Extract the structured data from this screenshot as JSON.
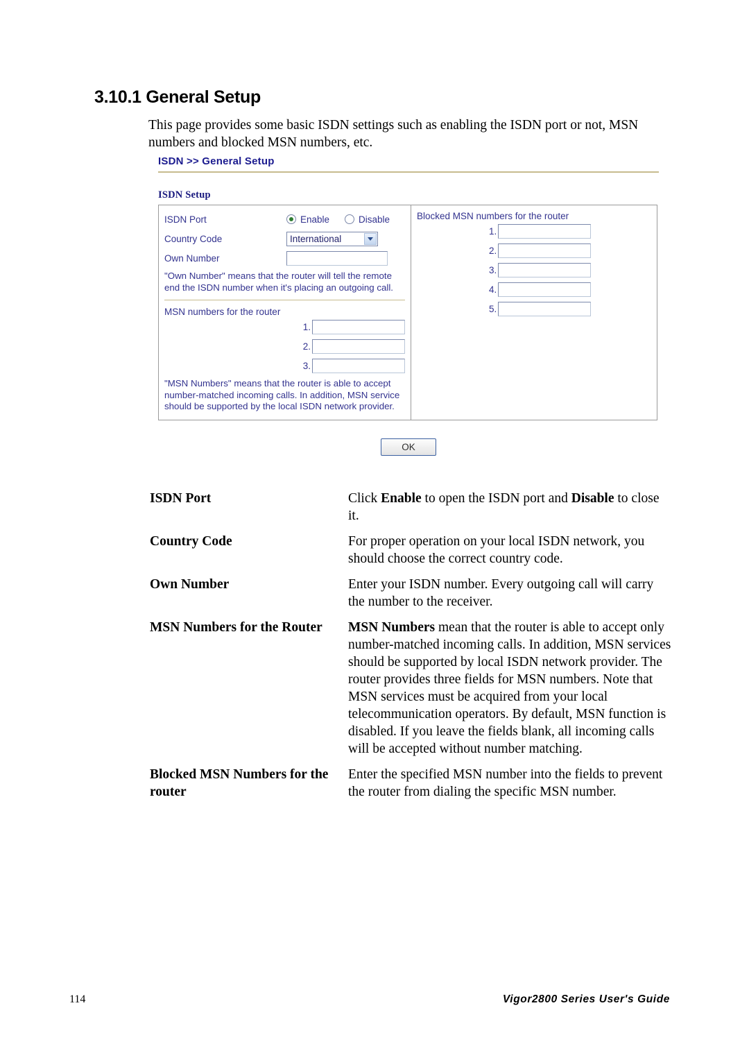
{
  "heading": "3.10.1 General Setup",
  "intro": "This page provides some basic ISDN settings such as enabling the ISDN port or not, MSN numbers and blocked MSN numbers, etc.",
  "screenshot": {
    "breadcrumb": "ISDN >> General Setup",
    "section_label": "ISDN Setup",
    "left": {
      "isdn_port_label": "ISDN Port",
      "enable_label": "Enable",
      "disable_label": "Disable",
      "enable_selected": true,
      "country_code_label": "Country Code",
      "country_code_value": "International",
      "own_number_label": "Own Number",
      "own_number_value": "",
      "own_number_note": "\"Own Number\" means that the router will tell the remote end the ISDN number when it's placing an outgoing call.",
      "msn_title": "MSN numbers for the router",
      "msn_rows": [
        {
          "index": "1.",
          "value": ""
        },
        {
          "index": "2.",
          "value": ""
        },
        {
          "index": "3.",
          "value": ""
        }
      ],
      "msn_note": "\"MSN Numbers\" means that the router is able to accept number-matched incoming calls. In addition, MSN service should be supported by the local ISDN network provider."
    },
    "right": {
      "blocked_title": "Blocked MSN numbers for the router",
      "blocked_rows": [
        {
          "index": "1.",
          "value": ""
        },
        {
          "index": "2.",
          "value": ""
        },
        {
          "index": "3.",
          "value": ""
        },
        {
          "index": "4.",
          "value": ""
        },
        {
          "index": "5.",
          "value": ""
        }
      ]
    },
    "ok_label": "OK"
  },
  "definitions": [
    {
      "term": "ISDN Port",
      "parts": [
        {
          "text": "Click ",
          "bold": false
        },
        {
          "text": "Enable",
          "bold": true
        },
        {
          "text": " to open the ISDN port and ",
          "bold": false
        },
        {
          "text": "Disable",
          "bold": true
        },
        {
          "text": " to close it.",
          "bold": false
        }
      ]
    },
    {
      "term": "Country Code",
      "parts": [
        {
          "text": "For proper operation on your local ISDN network, you should choose the correct country code.",
          "bold": false
        }
      ]
    },
    {
      "term": "Own Number",
      "parts": [
        {
          "text": "Enter your ISDN number. Every outgoing call will carry the number to the receiver.",
          "bold": false
        }
      ]
    },
    {
      "term": "MSN Numbers for the Router",
      "parts": [
        {
          "text": "MSN Numbers",
          "bold": true
        },
        {
          "text": " mean that the router is able to accept only number-matched incoming calls. In addition, MSN services should be supported by local ISDN network provider. The router provides three fields for MSN numbers. Note that MSN services must be acquired from your local telecommunication operators. By default, MSN function is disabled. If you leave the fields blank, all incoming calls will be accepted without number matching.",
          "bold": false
        }
      ]
    },
    {
      "term": "Blocked MSN Numbers for the router",
      "parts": [
        {
          "text": "Enter the specified MSN number into the fields to prevent the router from dialing the specific MSN number.",
          "bold": false
        }
      ]
    }
  ],
  "footer": {
    "page_number": "114",
    "guide_title": "Vigor2800 Series User's Guide"
  },
  "colors": {
    "ui_text": "#33338f",
    "ui_title": "#1b1b8f",
    "rule": "#c7bb8e",
    "radio_on": "#2f7d32"
  }
}
